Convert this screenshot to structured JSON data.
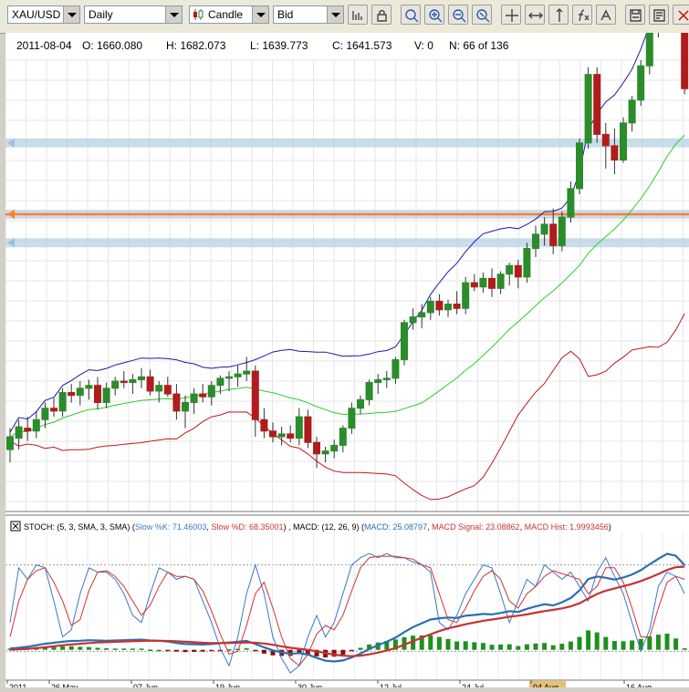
{
  "toolbar": {
    "symbol": "XAU/USD",
    "timeframe": "Daily",
    "chart_style": "Candle",
    "price_side": "Bid",
    "icons": [
      "bar-chart-icon",
      "lock-icon",
      "zoom-in-icon",
      "zoom-plus-icon",
      "zoom-minus-icon",
      "zoom-out-icon",
      "crosshair-icon",
      "scroll-icon",
      "vertical-line-icon",
      "function-icon",
      "drawing-icon",
      "save-icon",
      "gif-export-icon",
      "close-icon"
    ]
  },
  "ohlc_readout": {
    "date": "2011-08-04",
    "open": "O: 1660.080",
    "high": "H: 1682.073",
    "low": "L: 1639.773",
    "close": "C: 1641.573",
    "volume": "V: 0",
    "index": "N: 66 of 136"
  },
  "indicator_legend": {
    "stoch_prefix": "STOCH: (5, 3, SMA, 3, SMA) (",
    "slow_k": "Slow %K: 71.46003",
    "slow_d": "Slow %D: 68.35001",
    "macd_prefix": ") , MACD: (12, 26, 9) (",
    "macd": "MACD: 25.08797",
    "macd_signal": "MACD Signal: 23.08862",
    "macd_hist": "MACD Hist: 1.9993456",
    "suffix": ")"
  },
  "x_axis_labels": [
    "2011",
    "26 May",
    "07 Jun",
    "19 Jun",
    "30 Jun",
    "12 Jul",
    "24 Jul",
    "04 Aug",
    "16 Aug"
  ],
  "highlighted_label": "04 Aug",
  "colors": {
    "up_candle": "#2a8c2a",
    "down_candle": "#b01c1c",
    "upper_band": "#1a1aa8",
    "middle_band": "#2ecc2e",
    "lower_band": "#c01818",
    "horizontal_band": "#b8d2e4",
    "horizontal_line": "#ff7f2a",
    "stoch_k": "#3a78c8",
    "stoch_d": "#d43030",
    "macd_line": "#2a6fb0",
    "macd_signal": "#c83232",
    "macd_hist_up": "#1f8f1f",
    "macd_hist_down": "#8b1010"
  },
  "chart_data": {
    "type": "candlestick",
    "instrument": "XAU/USD",
    "timeframe": "Daily",
    "candles": [
      {
        "o": 1497,
        "h": 1512,
        "l": 1488,
        "c": 1506
      },
      {
        "o": 1505,
        "h": 1518,
        "l": 1497,
        "c": 1513
      },
      {
        "o": 1512,
        "h": 1520,
        "l": 1503,
        "c": 1510
      },
      {
        "o": 1510,
        "h": 1524,
        "l": 1505,
        "c": 1518
      },
      {
        "o": 1518,
        "h": 1530,
        "l": 1512,
        "c": 1526
      },
      {
        "o": 1526,
        "h": 1533,
        "l": 1520,
        "c": 1524
      },
      {
        "o": 1524,
        "h": 1540,
        "l": 1520,
        "c": 1537
      },
      {
        "o": 1537,
        "h": 1543,
        "l": 1530,
        "c": 1535
      },
      {
        "o": 1535,
        "h": 1545,
        "l": 1528,
        "c": 1540
      },
      {
        "o": 1540,
        "h": 1546,
        "l": 1532,
        "c": 1542
      },
      {
        "o": 1542,
        "h": 1548,
        "l": 1525,
        "c": 1530
      },
      {
        "o": 1530,
        "h": 1544,
        "l": 1526,
        "c": 1540
      },
      {
        "o": 1540,
        "h": 1548,
        "l": 1535,
        "c": 1545
      },
      {
        "o": 1545,
        "h": 1552,
        "l": 1540,
        "c": 1544
      },
      {
        "o": 1544,
        "h": 1550,
        "l": 1536,
        "c": 1546
      },
      {
        "o": 1546,
        "h": 1554,
        "l": 1540,
        "c": 1548
      },
      {
        "o": 1548,
        "h": 1553,
        "l": 1535,
        "c": 1538
      },
      {
        "o": 1538,
        "h": 1545,
        "l": 1530,
        "c": 1542
      },
      {
        "o": 1542,
        "h": 1548,
        "l": 1534,
        "c": 1536
      },
      {
        "o": 1536,
        "h": 1543,
        "l": 1518,
        "c": 1524
      },
      {
        "o": 1524,
        "h": 1535,
        "l": 1512,
        "c": 1530
      },
      {
        "o": 1530,
        "h": 1540,
        "l": 1522,
        "c": 1536
      },
      {
        "o": 1536,
        "h": 1543,
        "l": 1530,
        "c": 1534
      },
      {
        "o": 1534,
        "h": 1545,
        "l": 1528,
        "c": 1542
      },
      {
        "o": 1542,
        "h": 1549,
        "l": 1536,
        "c": 1547
      },
      {
        "o": 1547,
        "h": 1552,
        "l": 1538,
        "c": 1548
      },
      {
        "o": 1548,
        "h": 1556,
        "l": 1541,
        "c": 1550
      },
      {
        "o": 1550,
        "h": 1562,
        "l": 1545,
        "c": 1552
      },
      {
        "o": 1552,
        "h": 1556,
        "l": 1506,
        "c": 1518
      },
      {
        "o": 1518,
        "h": 1526,
        "l": 1505,
        "c": 1510
      },
      {
        "o": 1510,
        "h": 1516,
        "l": 1502,
        "c": 1506
      },
      {
        "o": 1506,
        "h": 1513,
        "l": 1500,
        "c": 1508
      },
      {
        "o": 1508,
        "h": 1514,
        "l": 1502,
        "c": 1505
      },
      {
        "o": 1505,
        "h": 1526,
        "l": 1500,
        "c": 1520
      },
      {
        "o": 1520,
        "h": 1525,
        "l": 1498,
        "c": 1502
      },
      {
        "o": 1502,
        "h": 1506,
        "l": 1484,
        "c": 1494
      },
      {
        "o": 1494,
        "h": 1499,
        "l": 1488,
        "c": 1496
      },
      {
        "o": 1496,
        "h": 1504,
        "l": 1491,
        "c": 1500
      },
      {
        "o": 1500,
        "h": 1514,
        "l": 1495,
        "c": 1512
      },
      {
        "o": 1512,
        "h": 1530,
        "l": 1508,
        "c": 1526
      },
      {
        "o": 1526,
        "h": 1535,
        "l": 1522,
        "c": 1532
      },
      {
        "o": 1532,
        "h": 1546,
        "l": 1528,
        "c": 1544
      },
      {
        "o": 1544,
        "h": 1550,
        "l": 1536,
        "c": 1546
      },
      {
        "o": 1546,
        "h": 1552,
        "l": 1540,
        "c": 1547
      },
      {
        "o": 1547,
        "h": 1562,
        "l": 1543,
        "c": 1560
      },
      {
        "o": 1560,
        "h": 1588,
        "l": 1556,
        "c": 1586
      },
      {
        "o": 1586,
        "h": 1596,
        "l": 1581,
        "c": 1590
      },
      {
        "o": 1590,
        "h": 1599,
        "l": 1582,
        "c": 1593
      },
      {
        "o": 1593,
        "h": 1604,
        "l": 1588,
        "c": 1601
      },
      {
        "o": 1601,
        "h": 1606,
        "l": 1591,
        "c": 1595
      },
      {
        "o": 1595,
        "h": 1602,
        "l": 1590,
        "c": 1599
      },
      {
        "o": 1599,
        "h": 1608,
        "l": 1592,
        "c": 1596
      },
      {
        "o": 1596,
        "h": 1618,
        "l": 1592,
        "c": 1614
      },
      {
        "o": 1614,
        "h": 1620,
        "l": 1608,
        "c": 1611
      },
      {
        "o": 1611,
        "h": 1621,
        "l": 1607,
        "c": 1617
      },
      {
        "o": 1617,
        "h": 1624,
        "l": 1604,
        "c": 1610
      },
      {
        "o": 1610,
        "h": 1622,
        "l": 1606,
        "c": 1620
      },
      {
        "o": 1620,
        "h": 1628,
        "l": 1612,
        "c": 1626
      },
      {
        "o": 1626,
        "h": 1630,
        "l": 1610,
        "c": 1618
      },
      {
        "o": 1618,
        "h": 1642,
        "l": 1614,
        "c": 1638
      },
      {
        "o": 1638,
        "h": 1654,
        "l": 1632,
        "c": 1648
      },
      {
        "o": 1648,
        "h": 1660,
        "l": 1640,
        "c": 1655
      },
      {
        "o": 1655,
        "h": 1666,
        "l": 1634,
        "c": 1640
      },
      {
        "o": 1640,
        "h": 1664,
        "l": 1636,
        "c": 1660
      },
      {
        "o": 1660,
        "h": 1685,
        "l": 1656,
        "c": 1680
      },
      {
        "o": 1680,
        "h": 1715,
        "l": 1676,
        "c": 1712
      },
      {
        "o": 1712,
        "h": 1765,
        "l": 1708,
        "c": 1760
      },
      {
        "o": 1760,
        "h": 1765,
        "l": 1712,
        "c": 1718
      },
      {
        "o": 1718,
        "h": 1726,
        "l": 1694,
        "c": 1710
      },
      {
        "o": 1710,
        "h": 1722,
        "l": 1690,
        "c": 1700
      },
      {
        "o": 1700,
        "h": 1730,
        "l": 1698,
        "c": 1726
      },
      {
        "o": 1726,
        "h": 1745,
        "l": 1720,
        "c": 1742
      },
      {
        "o": 1742,
        "h": 1770,
        "l": 1738,
        "c": 1766
      },
      {
        "o": 1766,
        "h": 1795,
        "l": 1760,
        "c": 1790
      },
      {
        "o": 1790,
        "h": 1820,
        "l": 1786,
        "c": 1816
      },
      {
        "o": 1816,
        "h": 1830,
        "l": 1810,
        "c": 1826
      },
      {
        "o": 1826,
        "h": 1832,
        "l": 1790,
        "c": 1794
      },
      {
        "o": 1794,
        "h": 1806,
        "l": 1746,
        "c": 1750
      }
    ],
    "horizontal_levels": [
      1712,
      1662,
      1642
    ],
    "highlight_level": 1662,
    "indicators": [
      "Bollinger Bands",
      "STOCH (5, 3, SMA, 3, SMA)",
      "MACD (12, 26, 9)"
    ],
    "stoch_k": [
      40,
      78,
      70,
      80,
      78,
      55,
      30,
      35,
      60,
      78,
      75,
      75,
      70,
      60,
      45,
      40,
      60,
      78,
      75,
      70,
      72,
      70,
      55,
      40,
      22,
      10,
      30,
      60,
      80,
      60,
      30,
      15,
      5,
      10,
      30,
      45,
      30,
      40,
      60,
      80,
      85,
      88,
      85,
      88,
      85,
      85,
      82,
      80,
      75,
      40,
      35,
      45,
      60,
      70,
      80,
      78,
      60,
      40,
      55,
      70,
      65,
      80,
      75,
      70,
      75,
      65,
      55,
      75,
      85,
      72,
      60,
      40,
      20,
      35,
      65,
      75,
      72,
      60
    ],
    "stoch_d": [
      30,
      55,
      70,
      76,
      78,
      68,
      55,
      38,
      42,
      62,
      75,
      76,
      72,
      65,
      55,
      45,
      52,
      65,
      75,
      72,
      72,
      70,
      62,
      48,
      32,
      18,
      20,
      38,
      60,
      68,
      50,
      30,
      15,
      10,
      18,
      32,
      38,
      35,
      45,
      62,
      78,
      85,
      86,
      86,
      86,
      85,
      84,
      80,
      78,
      60,
      42,
      40,
      50,
      62,
      72,
      76,
      70,
      55,
      50,
      60,
      65,
      72,
      76,
      74,
      72,
      70,
      60,
      65,
      78,
      78,
      68,
      50,
      30,
      30,
      50,
      68,
      72,
      70
    ],
    "macd": [
      0.5,
      0.8,
      1.2,
      1.8,
      2.4,
      2.8,
      3.2,
      3.5,
      3.6,
      3.8,
      3.7,
      3.6,
      3.7,
      3.8,
      3.9,
      4.0,
      3.7,
      3.6,
      3.3,
      2.7,
      2.3,
      2.2,
      2.1,
      2.3,
      2.6,
      2.9,
      3.2,
      3.5,
      2.3,
      1.0,
      -0.2,
      -1.0,
      -1.6,
      -1.3,
      -1.9,
      -3.2,
      -4.3,
      -4.6,
      -4.2,
      -3.0,
      -1.5,
      0.3,
      1.8,
      3.2,
      4.8,
      7.0,
      9.0,
      10.5,
      12.0,
      12.5,
      12.8,
      12.6,
      13.5,
      13.8,
      14.2,
      14.0,
      14.6,
      15.3,
      15.0,
      16.2,
      17.2,
      18.0,
      17.6,
      18.8,
      20.5,
      23.5,
      28.0,
      29.0,
      28.5,
      27.8,
      28.6,
      29.8,
      31.5,
      33.8,
      36.0,
      38.0,
      37.2,
      33.5
    ],
    "macd_signal": [
      0.0,
      0.2,
      0.4,
      0.7,
      1.0,
      1.4,
      1.8,
      2.1,
      2.4,
      2.7,
      2.9,
      3.0,
      3.2,
      3.3,
      3.4,
      3.5,
      3.6,
      3.6,
      3.5,
      3.4,
      3.2,
      3.0,
      2.8,
      2.7,
      2.7,
      2.7,
      2.8,
      2.9,
      2.8,
      2.5,
      2.0,
      1.4,
      0.8,
      0.4,
      0.0,
      -0.6,
      -1.3,
      -1.9,
      -2.3,
      -2.5,
      -2.3,
      -1.8,
      -1.1,
      -0.3,
      0.7,
      2.0,
      3.4,
      4.8,
      6.2,
      7.4,
      8.5,
      9.3,
      10.1,
      10.8,
      11.5,
      12.0,
      12.5,
      13.1,
      13.5,
      14.0,
      14.7,
      15.3,
      15.8,
      16.4,
      17.2,
      18.4,
      20.3,
      22.1,
      23.4,
      24.3,
      25.2,
      26.1,
      27.2,
      28.5,
      30.0,
      31.6,
      32.7,
      32.9
    ]
  }
}
